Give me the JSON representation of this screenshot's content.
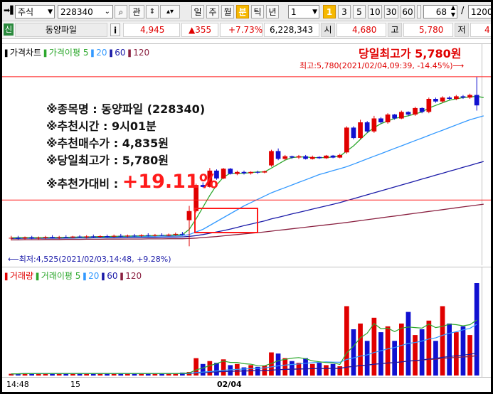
{
  "toolbar": {
    "market": "주식",
    "code": "228340",
    "kwan": "관",
    "periods": [
      "일",
      "주",
      "월",
      "분",
      "틱",
      "년"
    ],
    "active_period": "분",
    "interval_value": "1",
    "intervals": [
      "1",
      "3",
      "5",
      "10",
      "30",
      "60"
    ],
    "active_interval": "1",
    "count_value": "68",
    "slash": "/",
    "total_value": "1200"
  },
  "quote": {
    "badge": "신",
    "name": "동양파일",
    "info": "i",
    "price": "4,945",
    "change": "▲355",
    "change_pct": "+7.73%",
    "volume": "6,228,343",
    "open_label": "시",
    "open": "4,680",
    "high_label": "고",
    "high": "5,780",
    "low_label": "저",
    "low_fragment": "4"
  },
  "price_panel": {
    "legend": [
      {
        "text": "가격차트",
        "color": "#000000"
      },
      {
        "text": "가격이평 5",
        "color": "#2ea82e"
      },
      {
        "text": "20",
        "color": "#3399ff"
      },
      {
        "text": "60",
        "color": "#1a1aa8"
      },
      {
        "text": "120",
        "color": "#8a2040"
      }
    ],
    "headline": "당일최고가 5,780원",
    "high_note": "최고:5,780(2021/02/04,09:39, -14.45%)⟶",
    "low_note": "⟵최저:4,525(2021/02/03,14:48, +9.28%)",
    "info_lines": [
      "※종목명 : 동양파일 (228340)",
      "※추천시간 : 9시01분",
      "※추천매수가 : 4,835원",
      "※당일최고가 : 5,780원"
    ],
    "gain_label": "※추천가대비 : ",
    "gain_value": "+19.11%"
  },
  "volume_panel": {
    "legend": [
      {
        "text": "거래량",
        "color": "#e00000"
      },
      {
        "text": "거래이평 5",
        "color": "#2ea82e"
      },
      {
        "text": "20",
        "color": "#3399ff"
      },
      {
        "text": "60",
        "color": "#1a1aa8"
      },
      {
        "text": "120",
        "color": "#8a2040"
      }
    ]
  },
  "time_axis": [
    "14:48",
    "15",
    "02/04"
  ],
  "colors": {
    "up": "#e00000",
    "down": "#1010d0",
    "ma5": "#2ea82e",
    "ma20": "#3399ff",
    "ma60": "#1a1aa8",
    "ma120": "#8a2040",
    "highlight": "#ff1a1a"
  },
  "chart_data": {
    "type": "candlestick",
    "price_ylim": [
      4400,
      5850
    ],
    "candles": [
      {
        "o": 4540,
        "h": 4560,
        "l": 4525,
        "c": 4545
      },
      {
        "o": 4545,
        "h": 4560,
        "l": 4530,
        "c": 4540
      },
      {
        "o": 4540,
        "h": 4555,
        "l": 4530,
        "c": 4548
      },
      {
        "o": 4548,
        "h": 4560,
        "l": 4535,
        "c": 4540
      },
      {
        "o": 4540,
        "h": 4555,
        "l": 4530,
        "c": 4545
      },
      {
        "o": 4545,
        "h": 4560,
        "l": 4535,
        "c": 4552
      },
      {
        "o": 4552,
        "h": 4565,
        "l": 4540,
        "c": 4545
      },
      {
        "o": 4545,
        "h": 4560,
        "l": 4535,
        "c": 4550
      },
      {
        "o": 4550,
        "h": 4565,
        "l": 4540,
        "c": 4548
      },
      {
        "o": 4548,
        "h": 4560,
        "l": 4540,
        "c": 4555
      },
      {
        "o": 4555,
        "h": 4565,
        "l": 4545,
        "c": 4550
      },
      {
        "o": 4550,
        "h": 4565,
        "l": 4540,
        "c": 4556
      },
      {
        "o": 4556,
        "h": 4570,
        "l": 4545,
        "c": 4552
      },
      {
        "o": 4552,
        "h": 4565,
        "l": 4545,
        "c": 4558
      },
      {
        "o": 4558,
        "h": 4570,
        "l": 4548,
        "c": 4554
      },
      {
        "o": 4554,
        "h": 4570,
        "l": 4548,
        "c": 4560
      },
      {
        "o": 4560,
        "h": 4575,
        "l": 4550,
        "c": 4556
      },
      {
        "o": 4556,
        "h": 4570,
        "l": 4550,
        "c": 4562
      },
      {
        "o": 4562,
        "h": 4575,
        "l": 4552,
        "c": 4558
      },
      {
        "o": 4558,
        "h": 4572,
        "l": 4552,
        "c": 4565
      },
      {
        "o": 4565,
        "h": 4580,
        "l": 4555,
        "c": 4560
      },
      {
        "o": 4560,
        "h": 4575,
        "l": 4555,
        "c": 4566
      },
      {
        "o": 4566,
        "h": 4580,
        "l": 4558,
        "c": 4562
      },
      {
        "o": 4562,
        "h": 4578,
        "l": 4558,
        "c": 4570
      },
      {
        "o": 4570,
        "h": 4585,
        "l": 4560,
        "c": 4575
      },
      {
        "o": 4575,
        "h": 4590,
        "l": 4565,
        "c": 4572
      },
      {
        "o": 4680,
        "h": 4790,
        "l": 4480,
        "c": 4750
      },
      {
        "o": 4750,
        "h": 4960,
        "l": 4740,
        "c": 4950
      },
      {
        "o": 4950,
        "h": 4970,
        "l": 4930,
        "c": 4935
      },
      {
        "o": 4935,
        "h": 5080,
        "l": 4930,
        "c": 5060
      },
      {
        "o": 5060,
        "h": 5070,
        "l": 4990,
        "c": 5000
      },
      {
        "o": 5000,
        "h": 5080,
        "l": 4995,
        "c": 5075
      },
      {
        "o": 5075,
        "h": 5080,
        "l": 5030,
        "c": 5035
      },
      {
        "o": 5035,
        "h": 5060,
        "l": 5025,
        "c": 5050
      },
      {
        "o": 5050,
        "h": 5060,
        "l": 5030,
        "c": 5040
      },
      {
        "o": 5040,
        "h": 5055,
        "l": 5030,
        "c": 5050
      },
      {
        "o": 5050,
        "h": 5060,
        "l": 5035,
        "c": 5045
      },
      {
        "o": 5045,
        "h": 5060,
        "l": 5040,
        "c": 5055
      },
      {
        "o": 5100,
        "h": 5220,
        "l": 5090,
        "c": 5210
      },
      {
        "o": 5210,
        "h": 5230,
        "l": 5140,
        "c": 5150
      },
      {
        "o": 5150,
        "h": 5180,
        "l": 5140,
        "c": 5170
      },
      {
        "o": 5170,
        "h": 5175,
        "l": 5150,
        "c": 5160
      },
      {
        "o": 5160,
        "h": 5180,
        "l": 5150,
        "c": 5170
      },
      {
        "o": 5170,
        "h": 5180,
        "l": 5145,
        "c": 5150
      },
      {
        "o": 5150,
        "h": 5175,
        "l": 5145,
        "c": 5165
      },
      {
        "o": 5165,
        "h": 5170,
        "l": 5150,
        "c": 5155
      },
      {
        "o": 5155,
        "h": 5180,
        "l": 5150,
        "c": 5175
      },
      {
        "o": 5175,
        "h": 5180,
        "l": 5155,
        "c": 5160
      },
      {
        "o": 5160,
        "h": 5190,
        "l": 5155,
        "c": 5180
      },
      {
        "o": 5200,
        "h": 5400,
        "l": 5190,
        "c": 5390
      },
      {
        "o": 5390,
        "h": 5400,
        "l": 5300,
        "c": 5310
      },
      {
        "o": 5310,
        "h": 5450,
        "l": 5300,
        "c": 5430
      },
      {
        "o": 5430,
        "h": 5440,
        "l": 5350,
        "c": 5360
      },
      {
        "o": 5360,
        "h": 5480,
        "l": 5350,
        "c": 5460
      },
      {
        "o": 5460,
        "h": 5470,
        "l": 5420,
        "c": 5430
      },
      {
        "o": 5430,
        "h": 5500,
        "l": 5420,
        "c": 5490
      },
      {
        "o": 5490,
        "h": 5495,
        "l": 5450,
        "c": 5460
      },
      {
        "o": 5460,
        "h": 5520,
        "l": 5455,
        "c": 5510
      },
      {
        "o": 5510,
        "h": 5515,
        "l": 5480,
        "c": 5490
      },
      {
        "o": 5490,
        "h": 5550,
        "l": 5480,
        "c": 5540
      },
      {
        "o": 5540,
        "h": 5545,
        "l": 5500,
        "c": 5510
      },
      {
        "o": 5510,
        "h": 5620,
        "l": 5500,
        "c": 5610
      },
      {
        "o": 5610,
        "h": 5620,
        "l": 5580,
        "c": 5590
      },
      {
        "o": 5590,
        "h": 5630,
        "l": 5580,
        "c": 5620
      },
      {
        "o": 5620,
        "h": 5630,
        "l": 5600,
        "c": 5610
      },
      {
        "o": 5610,
        "h": 5640,
        "l": 5600,
        "c": 5630
      },
      {
        "o": 5630,
        "h": 5640,
        "l": 5610,
        "c": 5620
      },
      {
        "o": 5620,
        "h": 5650,
        "l": 5610,
        "c": 5640
      },
      {
        "o": 5640,
        "h": 5780,
        "l": 5520,
        "c": 5560
      }
    ],
    "volumes": [
      3,
      3,
      4,
      3,
      4,
      3,
      4,
      3,
      4,
      3,
      4,
      3,
      4,
      3,
      4,
      3,
      4,
      3,
      4,
      3,
      4,
      3,
      4,
      3,
      4,
      5,
      6,
      30,
      20,
      25,
      22,
      28,
      18,
      20,
      14,
      18,
      15,
      17,
      40,
      38,
      30,
      25,
      22,
      30,
      20,
      22,
      18,
      20,
      16,
      120,
      80,
      90,
      60,
      100,
      75,
      85,
      60,
      90,
      110,
      70,
      80,
      95,
      60,
      120,
      90,
      75,
      85,
      70,
      160
    ],
    "ma5": [
      4545,
      4546,
      4547,
      4547,
      4546,
      4547,
      4548,
      4548,
      4549,
      4550,
      4551,
      4552,
      4553,
      4554,
      4555,
      4556,
      4557,
      4558,
      4559,
      4560,
      4561,
      4562,
      4563,
      4565,
      4567,
      4569,
      4610,
      4690,
      4780,
      4870,
      4950,
      5010,
      5040,
      5040,
      5040,
      5045,
      5050,
      5050,
      5080,
      5110,
      5140,
      5160,
      5165,
      5165,
      5160,
      5160,
      5160,
      5165,
      5170,
      5210,
      5250,
      5300,
      5350,
      5390,
      5420,
      5440,
      5460,
      5470,
      5480,
      5495,
      5510,
      5540,
      5560,
      5580,
      5600,
      5610,
      5620,
      5625,
      5630,
      5620
    ],
    "ma20": [
      4543,
      4543,
      4544,
      4544,
      4545,
      4545,
      4546,
      4546,
      4547,
      4548,
      4548,
      4549,
      4550,
      4550,
      4551,
      4552,
      4553,
      4553,
      4554,
      4555,
      4556,
      4557,
      4558,
      4559,
      4560,
      4561,
      4570,
      4590,
      4610,
      4640,
      4670,
      4700,
      4730,
      4760,
      4790,
      4815,
      4840,
      4865,
      4890,
      4910,
      4930,
      4950,
      4970,
      4990,
      5010,
      5030,
      5045,
      5060,
      5075,
      5090,
      5110,
      5130,
      5150,
      5170,
      5190,
      5210,
      5230,
      5250,
      5270,
      5290,
      5310,
      5330,
      5350,
      5370,
      5390,
      5410,
      5430,
      5450,
      5465,
      5480
    ],
    "ma60": [
      4540,
      4540,
      4541,
      4541,
      4541,
      4542,
      4542,
      4542,
      4543,
      4543,
      4544,
      4544,
      4545,
      4545,
      4546,
      4546,
      4547,
      4547,
      4548,
      4548,
      4549,
      4549,
      4550,
      4551,
      4551,
      4552,
      4556,
      4562,
      4570,
      4580,
      4590,
      4600,
      4612,
      4625,
      4638,
      4650,
      4662,
      4675,
      4690,
      4702,
      4715,
      4728,
      4740,
      4752,
      4765,
      4778,
      4790,
      4802,
      4815,
      4830,
      4845,
      4860,
      4875,
      4890,
      4905,
      4920,
      4935,
      4950,
      4965,
      4980,
      4995,
      5010,
      5025,
      5040,
      5055,
      5070,
      5085,
      5100,
      5115,
      5130
    ],
    "ma120": [
      4530,
      4530,
      4531,
      4531,
      4531,
      4532,
      4532,
      4532,
      4533,
      4533,
      4533,
      4534,
      4534,
      4534,
      4535,
      4535,
      4535,
      4536,
      4536,
      4536,
      4537,
      4537,
      4537,
      4538,
      4538,
      4538,
      4540,
      4543,
      4547,
      4551,
      4555,
      4560,
      4565,
      4570,
      4575,
      4580,
      4585,
      4590,
      4596,
      4602,
      4608,
      4614,
      4620,
      4626,
      4632,
      4638,
      4644,
      4650,
      4656,
      4663,
      4670,
      4677,
      4684,
      4691,
      4698,
      4705,
      4712,
      4719,
      4726,
      4733,
      4740,
      4747,
      4754,
      4761,
      4768,
      4775,
      4782,
      4789,
      4796,
      4803
    ]
  }
}
